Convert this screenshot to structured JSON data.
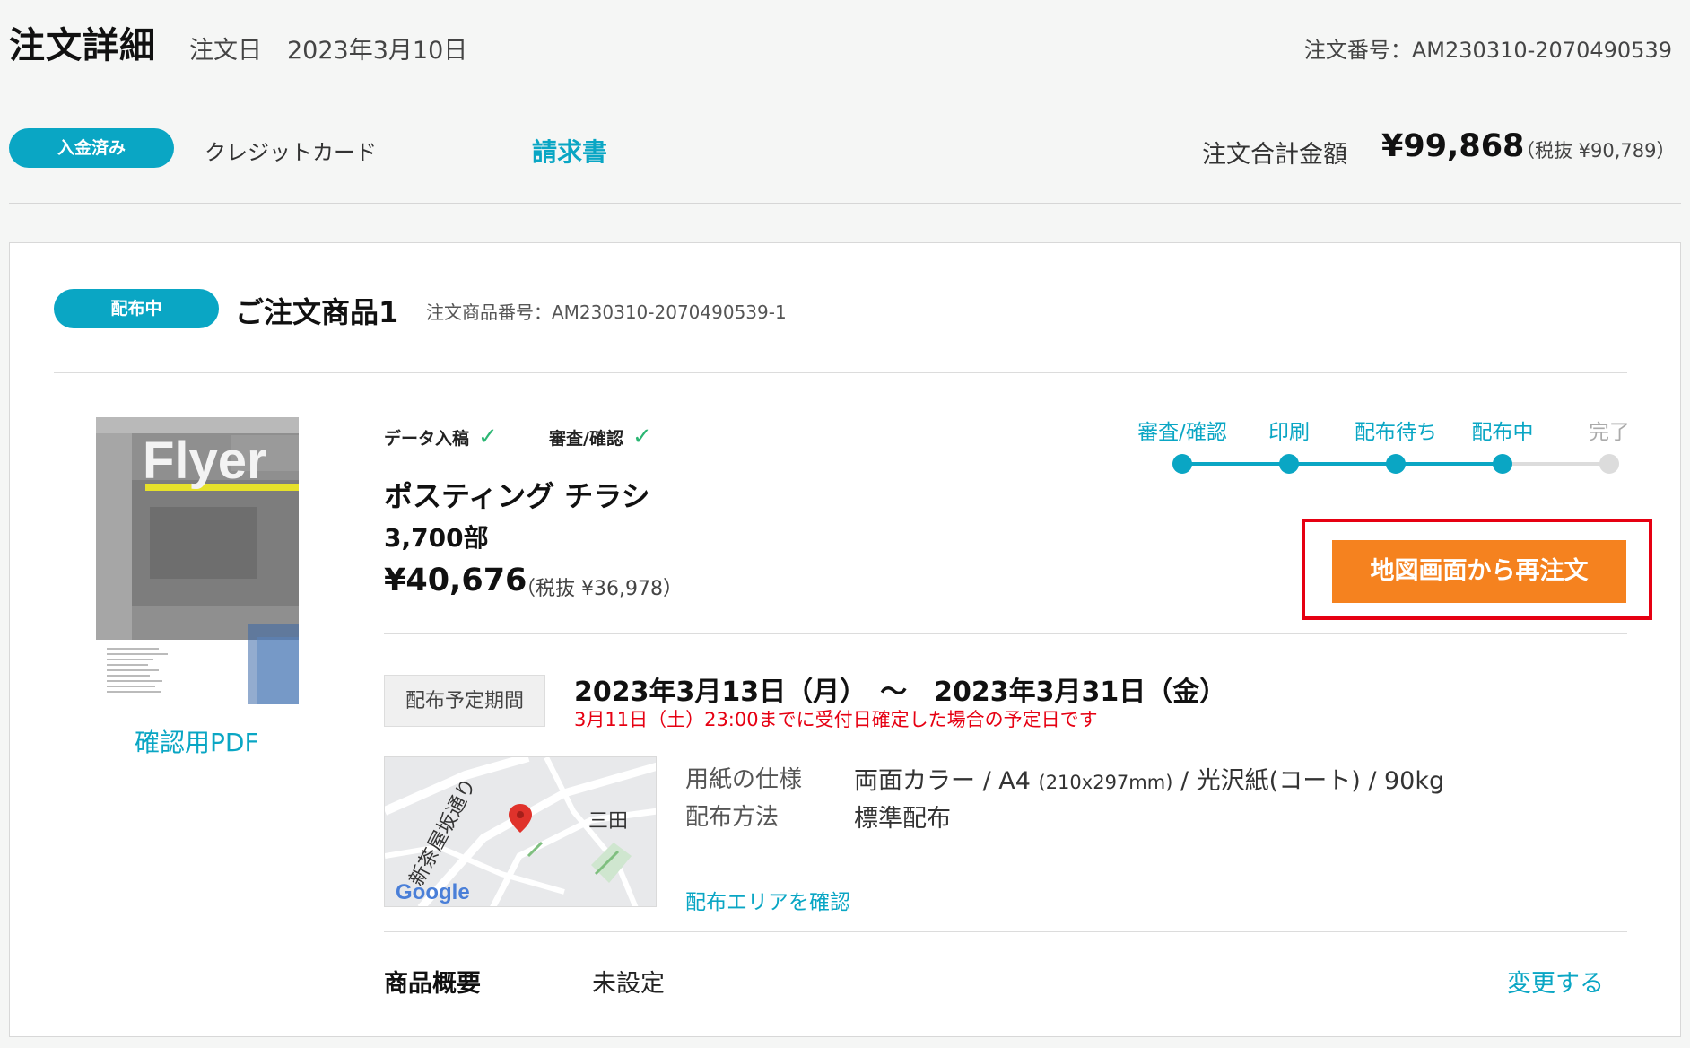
{
  "header": {
    "title": "注文詳細",
    "order_date_label": "注文日",
    "order_date": "2023年3月10日",
    "order_number": "注文番号：AM230310-2070490539"
  },
  "payment": {
    "status": "入金済み",
    "method": "クレジットカード",
    "invoice_link": "請求書",
    "total_label": "注文合計金額",
    "total_amount": "¥99,868",
    "total_tax": "（税抜 ¥90,789）"
  },
  "item": {
    "status": "配布中",
    "title": "ご注文商品1",
    "number": "注文商品番号：AM230310-2070490539-1",
    "thumbnail_text": "Flyer",
    "pdf_link": "確認用PDF",
    "checks": [
      "データ入稿",
      "審査/確認"
    ],
    "check_mark": "✓",
    "product_name": "ポスティング チラシ",
    "copies": "3,700部",
    "price": "¥40,676",
    "price_tax": "（税抜 ¥36,978）",
    "progress": {
      "steps": [
        "審査/確認",
        "印刷",
        "配布待ち",
        "配布中",
        "完了"
      ],
      "current_index": 3
    },
    "reorder_button": "地図画面から再注文",
    "period_label": "配布予定期間",
    "period_dates": "2023年3月13日（月）　～　2023年3月31日（金）",
    "period_note": "3月11日（土）23:00までに受付日確定した場合の予定日です",
    "map": {
      "street_label": "新茶屋坂通り",
      "place_label": "三田",
      "provider": "Google"
    },
    "specs": {
      "paper_label": "用紙の仕様",
      "paper_value_1": "両面カラー / A4 ",
      "paper_value_small": "(210x297mm)",
      "paper_value_2": " / 光沢紙(コート) / 90kg",
      "method_label": "配布方法",
      "method_value": "標準配布"
    },
    "area_link": "配布エリアを確認",
    "summary_label": "商品概要",
    "summary_value": "未設定",
    "change_link": "変更する"
  },
  "colors": {
    "accent": "#0aa6c4",
    "orange": "#f5821f",
    "red": "#e60012",
    "check_green": "#2bb673"
  }
}
